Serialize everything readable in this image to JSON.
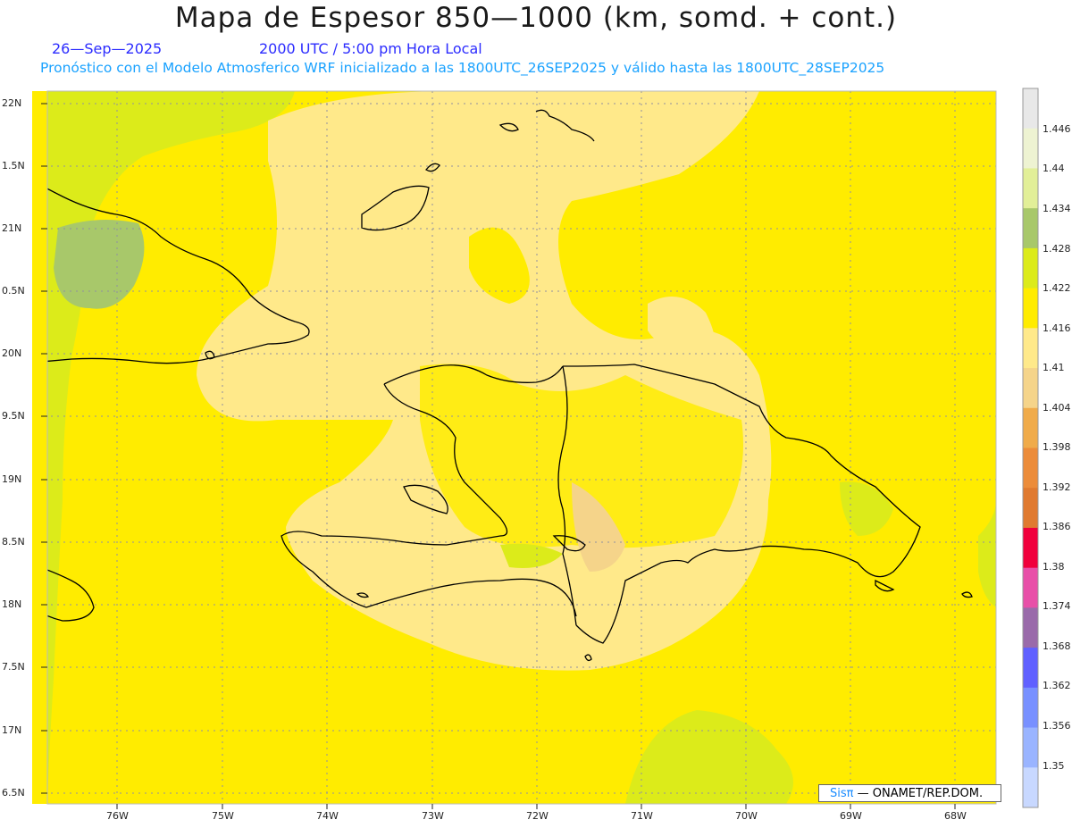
{
  "header": {
    "title": "Mapa de Espesor 850—1000 (km, somd. + cont.)",
    "date": "26—Sep—2025",
    "time": "2000 UTC / 5:00 pm Hora Local",
    "model_line": "Pronóstico con el Modelo Atmosferico WRF inicializado a las 1800UTC_26SEP2025 y válido hasta las  1800UTC_28SEP2025"
  },
  "axes": {
    "lat_labels": [
      "22N",
      "1.5N",
      "21N",
      "0.5N",
      "20N",
      "9.5N",
      "19N",
      "8.5N",
      "18N",
      "7.5N",
      "17N",
      "6.5N"
    ],
    "lon_labels": [
      "76W",
      "75W",
      "74W",
      "73W",
      "72W",
      "71W",
      "70W",
      "69W",
      "68W"
    ]
  },
  "colorbar": {
    "labels": [
      "1.446",
      "1.44",
      "1.434",
      "1.428",
      "1.422",
      "1.416",
      "1.41",
      "1.404",
      "1.398",
      "1.392",
      "1.386",
      "1.38",
      "1.374",
      "1.368",
      "1.362",
      "1.356",
      "1.35"
    ],
    "colors": [
      "#e8e8e8",
      "#eef3d2",
      "#e2ef98",
      "#a8c86a",
      "#dceb1a",
      "#ffec00",
      "#ffe98a",
      "#f5d48a",
      "#f0ab4a",
      "#ec8c3a",
      "#e07a30",
      "#f0003c",
      "#e84fa8",
      "#9a6aaa",
      "#6060ff",
      "#7890ff",
      "#9ab4ff",
      "#c8d8ff"
    ]
  },
  "credit": {
    "brand": "Sisπ",
    "text": "— ONAMET/REP.DOM."
  }
}
